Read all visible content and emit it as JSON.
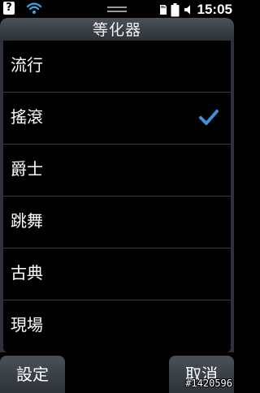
{
  "status_bar": {
    "left_icons": [
      "question-icon",
      "wifi-icon"
    ],
    "right_icons": [
      "sd-card-icon",
      "battery-icon",
      "speaker-icon"
    ],
    "question_glyph": "?",
    "time": "15:05"
  },
  "title": "等化器",
  "items": [
    {
      "label": "流行",
      "selected": false
    },
    {
      "label": "搖滾",
      "selected": true
    },
    {
      "label": "爵士",
      "selected": false
    },
    {
      "label": "跳舞",
      "selected": false
    },
    {
      "label": "古典",
      "selected": false
    },
    {
      "label": "現場",
      "selected": false
    }
  ],
  "buttons": {
    "left_label": "設定",
    "right_label": "取消"
  },
  "watermark": "#1420596",
  "colors": {
    "background": "#000000",
    "header_gradient_top": "#4a5157",
    "header_gradient_bottom": "#2c3237",
    "checkmark": "#3d8fd8",
    "divider": "#3a3a3a"
  }
}
